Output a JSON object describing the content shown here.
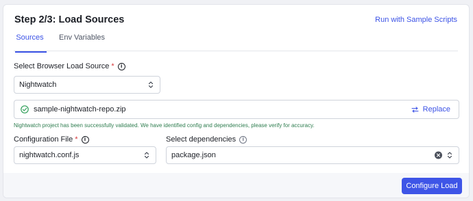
{
  "header": {
    "title": "Step 2/3: Load Sources",
    "sample_link": "Run with Sample Scripts"
  },
  "tabs": [
    {
      "label": "Sources",
      "active": true
    },
    {
      "label": "Env Variables",
      "active": false
    }
  ],
  "load_source": {
    "label": "Select Browser Load Source",
    "required_mark": "*",
    "value": "Nightwatch"
  },
  "file": {
    "name": "sample-nightwatch-repo.zip",
    "replace_label": "Replace",
    "success_message": "Nightwatch project has been successfully validated. We have identified config and dependencies, please verify for accuracy."
  },
  "config_file": {
    "label": "Configuration File",
    "required_mark": "*",
    "value": "nightwatch.conf.js"
  },
  "dependencies": {
    "label": "Select dependencies",
    "value": "package.json"
  },
  "footer": {
    "configure_label": "Configure Load"
  },
  "colors": {
    "accent": "#3b52e6",
    "success": "#2e7d4f",
    "required": "#d6373a"
  },
  "icons": [
    "info-icon",
    "chevron-updown-icon",
    "check-circle-icon",
    "swap-arrows-icon",
    "clear-icon"
  ]
}
